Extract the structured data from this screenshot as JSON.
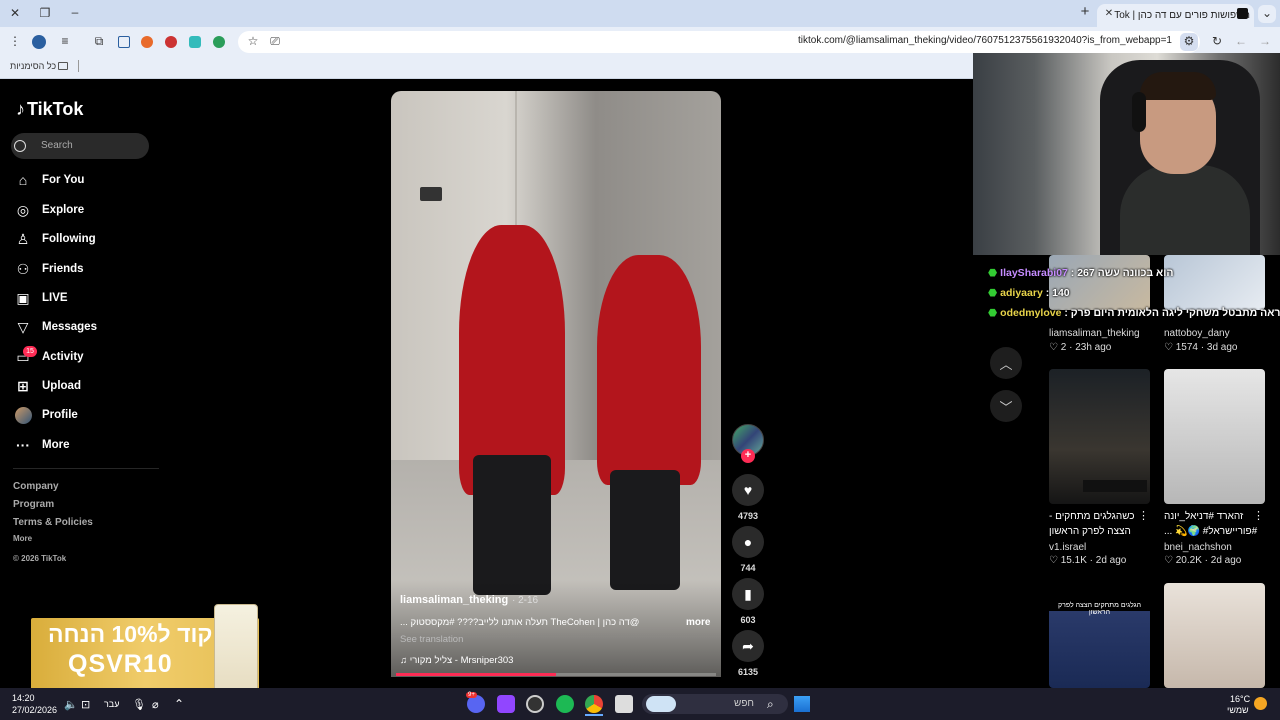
{
  "browser": {
    "tab_title": "חשפושות פורים עם דה כהן | Tok",
    "url": "tiktok.com/@liamsaliman_theking/video/7607512375561932040?is_from_webapp=1",
    "bookmarks_label": "כל הסימניות"
  },
  "tiktok": {
    "logo": "TikTok",
    "search_placeholder": "Search",
    "nav": [
      {
        "label": "For You",
        "icon": "home-icon"
      },
      {
        "label": "Explore",
        "icon": "compass-icon"
      },
      {
        "label": "Following",
        "icon": "user-check-icon"
      },
      {
        "label": "Friends",
        "icon": "users-icon"
      },
      {
        "label": "LIVE",
        "icon": "live-icon"
      },
      {
        "label": "Messages",
        "icon": "send-icon"
      },
      {
        "label": "Activity",
        "icon": "inbox-icon"
      },
      {
        "label": "Upload",
        "icon": "plus-square-icon"
      },
      {
        "label": "Profile",
        "icon": "avatar-icon"
      },
      {
        "label": "More",
        "icon": "ellipsis-icon"
      }
    ],
    "activity_badge": "15",
    "footer": [
      "Company",
      "Program",
      "Terms & Policies",
      "More",
      "© 2026 TikTok"
    ]
  },
  "video": {
    "author": "liamsaliman_theking",
    "date": "· 2-16",
    "caption": "@דה כהן | TheCohen תעלה אותנו ללייב???? #מקססטוק ...",
    "more": "more",
    "see_translation": "See translation",
    "music": "♫ צליל מקורי - Mrsniper303",
    "progress_fraction": 0.5,
    "likes": "4793",
    "comments": "744",
    "saves": "603",
    "shares": "6135"
  },
  "chat": [
    {
      "user": "IlaySharabi07",
      "text": " : 267 הוא בכוונה עשה",
      "color": "#c58cff"
    },
    {
      "user": "adiyaary",
      "text": " : 140",
      "color": "#e8d44a"
    },
    {
      "user": "odedmylove",
      "text": " : שכנראה מתבטל משחקי ליגה הלאומית היום פרק",
      "color": "#e8d44a"
    }
  ],
  "grid": [
    {
      "author": "liamsaliman_theking",
      "likes": "2",
      "age": "23h ago",
      "title": ""
    },
    {
      "author": "nattoboy_dany",
      "likes": "1574",
      "age": "3d ago",
      "title": ""
    },
    {
      "author": "v1.israel",
      "likes": "15.1K",
      "age": "2d ago",
      "title": "כשהגלגים מתחקים - הצצה לפרק הראשון"
    },
    {
      "author": "bnei_nachshon",
      "likes": "20.2K",
      "age": "2d ago",
      "title": "זהארד #דניאל_יונה #פוריישראל# 🌍💫 ..."
    },
    {
      "thumb_text": "הגלגים מתחקים הצצה לפרק הראשון"
    }
  ],
  "ad": {
    "line1": "קוד ל10% הנחה",
    "line2": "QSVR10"
  },
  "taskbar": {
    "time": "14:20",
    "date": "27/02/2026",
    "lang": "עבר",
    "search": "חפש",
    "weather_temp": "16°C",
    "weather_desc": "שמשי",
    "discord_badge": "9+"
  }
}
